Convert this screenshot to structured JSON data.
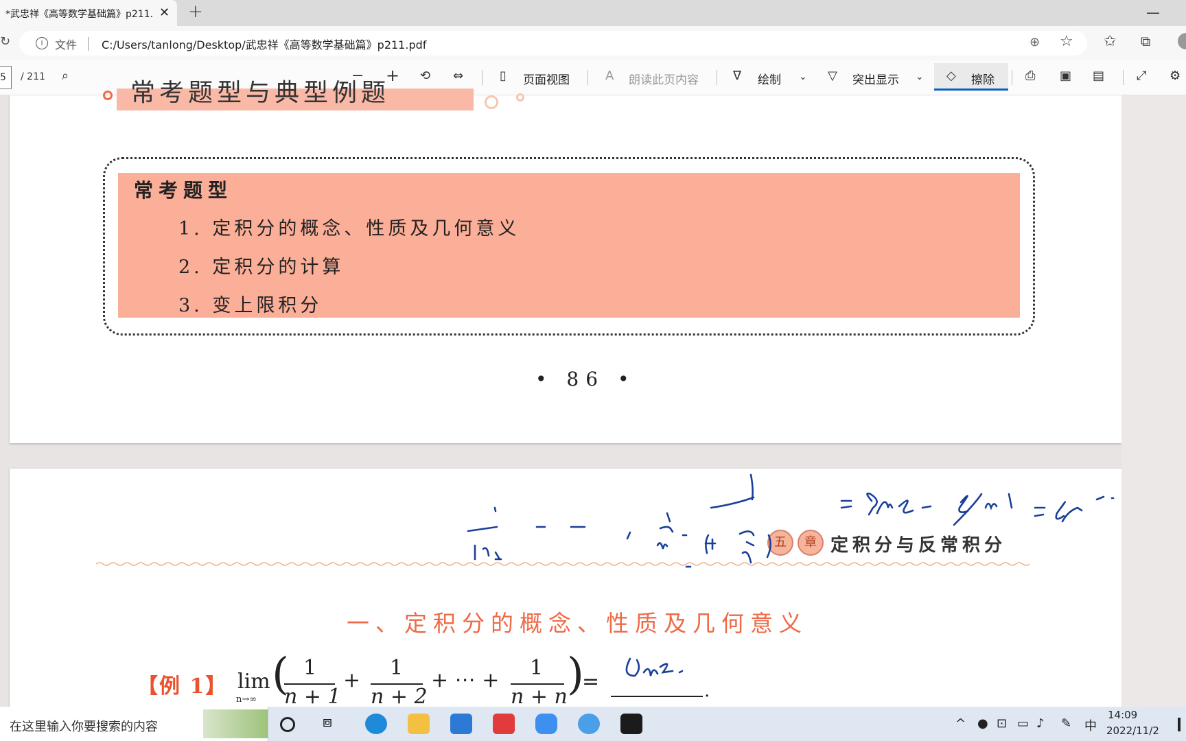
{
  "tab": {
    "title": "*武忠祥《高等数学基础篇》p211.pdf",
    "close": "✕",
    "new": "+"
  },
  "window": {
    "minimize": "—"
  },
  "address": {
    "label": "文件",
    "url": "C:/Users/tanlong/Desktop/武忠祥《高等数学基础篇》p211.pdf"
  },
  "pdf_toolbar": {
    "page_current": "5",
    "page_total": "/ 211",
    "page_view": "页面视图",
    "read_aloud": "朗读此页内容",
    "draw": "绘制",
    "highlight": "突出显示",
    "erase": "擦除"
  },
  "doc": {
    "section_title": "常考题型与典型例题",
    "box_heading": "常考题型",
    "box_items": [
      "1. 定积分的概念、性质及几何意义",
      "2. 定积分的计算",
      "3. 变上限积分"
    ],
    "page_number": "• 86 •",
    "chapter_badges": [
      "五",
      "章"
    ],
    "chapter_title": "定积分与反常积分",
    "subsection_title": "一、定积分的概念、性质及几何意义",
    "example_label": "【例 1】",
    "math": {
      "lim": "lim",
      "lim_sub": "n→∞",
      "numerator": "1",
      "den1": "n + 1",
      "den2": "n + 2",
      "den3": "n + n",
      "plus": "+",
      "dots": "+ ⋯ +",
      "open": "(",
      "close": ")",
      "equals": "=",
      "period": "."
    }
  },
  "taskbar": {
    "search_placeholder": "在这里输入你要搜索的内容",
    "ime": "中",
    "time": "14:09",
    "date": "2022/11/2"
  }
}
